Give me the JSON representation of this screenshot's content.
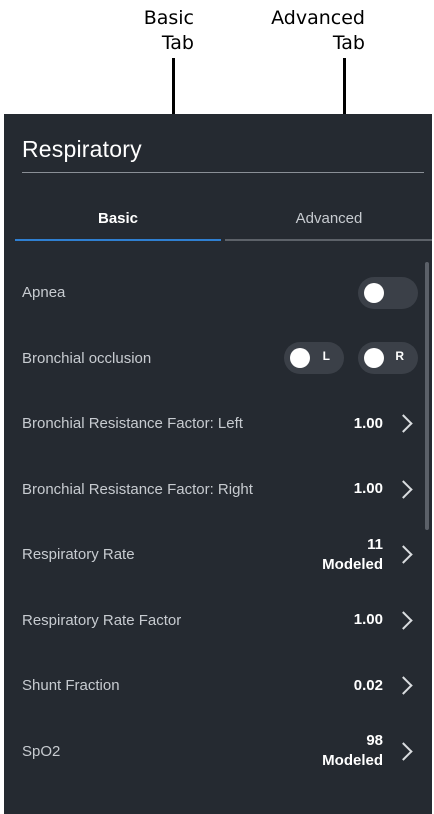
{
  "callouts": {
    "basic_line1": "Basic",
    "basic_line2": "Tab",
    "advanced_line1": "Advanced",
    "advanced_line2": "Tab"
  },
  "panel": {
    "title": "Respiratory",
    "tabs": [
      {
        "label": "Basic",
        "selected": true
      },
      {
        "label": "Advanced",
        "selected": false
      }
    ],
    "rows": [
      {
        "label": "Apnea",
        "control": "toggle",
        "on": false
      },
      {
        "label": "Bronchial occlusion",
        "control": "toggle-pair",
        "left_label": "L",
        "right_label": "R",
        "left_on": false,
        "right_on": false
      },
      {
        "label": "Bronchial Resistance Factor: Left",
        "value": "1.00"
      },
      {
        "label": "Bronchial Resistance Factor: Right",
        "value": "1.00"
      },
      {
        "label": "Respiratory Rate",
        "value": "11",
        "value2": "Modeled"
      },
      {
        "label": "Respiratory Rate Factor",
        "value": "1.00"
      },
      {
        "label": "Shunt Fraction",
        "value": "0.02"
      },
      {
        "label": "SpO2",
        "value": "98",
        "value2": "Modeled"
      }
    ]
  },
  "colors": {
    "panel_bg": "#252a31",
    "accent": "#2f7fd1",
    "label_text": "#c7cbd0",
    "toggle_track": "#3b4048"
  },
  "icons": [
    "chevron-right-icon"
  ]
}
